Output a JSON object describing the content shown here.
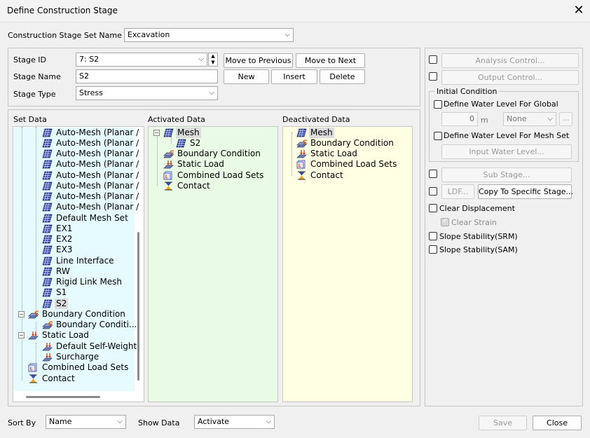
{
  "window": {
    "title": "Define Construction Stage"
  },
  "stage_set": {
    "label": "Construction Stage Set Name",
    "value": "Excavation"
  },
  "stage_id": {
    "label": "Stage ID",
    "value": "7: S2"
  },
  "stage_name": {
    "label": "Stage Name",
    "value": "S2"
  },
  "stage_type": {
    "label": "Stage Type",
    "value": "Stress"
  },
  "buttons": {
    "move_prev": "Move to Previous",
    "move_next": "Move to Next",
    "new": "New",
    "insert": "Insert",
    "delete": "Delete",
    "save": "Save",
    "close": "Close"
  },
  "right_panel": {
    "analysis_control": "Analysis Control...",
    "output_control": "Output Control...",
    "initial_condition": "Initial Condition",
    "define_water_global": "Define Water Level For Global",
    "water_value": "0",
    "water_unit": "m",
    "water_combo": "None",
    "ellipsis": "...",
    "define_water_mesh": "Define Water Level For Mesh Set",
    "input_water_level": "Input Water Level...",
    "sub_stage": "Sub Stage...",
    "ldf": "LDF...",
    "copy_specific": "Copy To Specific Stage...",
    "clear_displacement": "Clear Displacement",
    "clear_strain": "Clear Strain",
    "slope_srm": "Slope Stability(SRM)",
    "slope_sam": "Slope Stability(SAM)"
  },
  "set_data": {
    "header": "Set Data",
    "items": [
      "Auto-Mesh (Planar /",
      "Auto-Mesh (Planar /",
      "Auto-Mesh (Planar /",
      "Auto-Mesh (Planar /",
      "Auto-Mesh (Planar /",
      "Auto-Mesh (Planar /",
      "Auto-Mesh (Planar /",
      "Auto-Mesh (Planar /",
      "Default Mesh Set",
      "EX1",
      "EX2",
      "EX3",
      "Line Interface",
      "RW",
      "Rigid Link Mesh",
      "S1",
      "S2",
      "Boundary Condition",
      "Boundary Conditi...",
      "Static Load",
      "Default Self-Weight",
      "Surcharge",
      "Combined Load Sets",
      "Contact"
    ]
  },
  "activated_data": {
    "header": "Activated Data",
    "items": [
      "Mesh",
      "S2",
      "Boundary Condition",
      "Static Load",
      "Combined Load Sets",
      "Contact"
    ]
  },
  "deactivated_data": {
    "header": "Deactivated Data",
    "items": [
      "Mesh",
      "Boundary Condition",
      "Static Load",
      "Combined Load Sets",
      "Contact"
    ]
  },
  "bottom": {
    "sort_by_label": "Sort By",
    "sort_by_value": "Name",
    "show_data_label": "Show Data",
    "show_data_value": "Activate"
  },
  "colors": {
    "set_data_bg": "#e6fbff",
    "activated_bg": "#e9fbe4",
    "deactivated_bg": "#ffffe3",
    "mesh_icon": "#2b3a8c",
    "bc_icon": "#d0501f"
  }
}
